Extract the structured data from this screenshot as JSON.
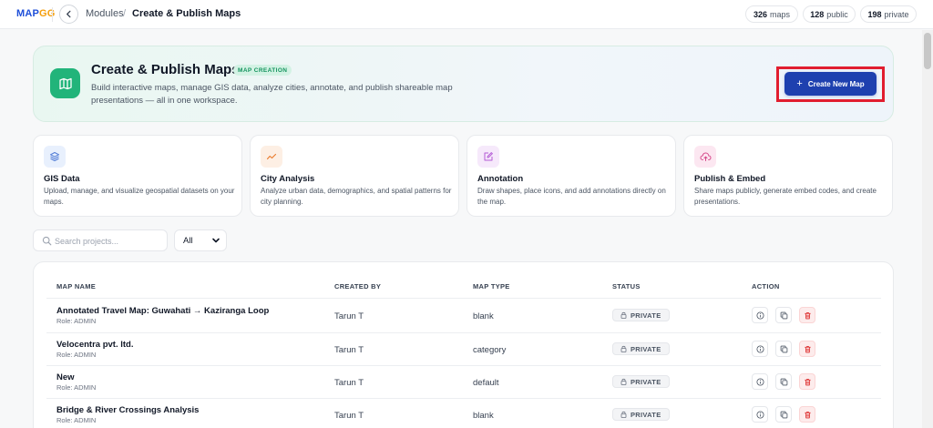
{
  "header": {
    "logo_prefix": "MAP",
    "logo_accent": "GG",
    "breadcrumb": {
      "parent": "Modules",
      "separator": "/",
      "current": "Create & Publish Maps"
    },
    "stats": [
      {
        "value": "326",
        "label": "maps"
      },
      {
        "value": "128",
        "label": "public"
      },
      {
        "value": "198",
        "label": "private"
      }
    ]
  },
  "hero": {
    "icon": "map-icon",
    "title": "Create & Publish Maps",
    "badge": "MAP CREATION",
    "description": "Build interactive maps, manage GIS data, analyze cities, annotate, and publish shareable map presentations — all in one workspace.",
    "cta_label": "Create New Map"
  },
  "features": [
    {
      "icon": "layers-icon",
      "title": "GIS Data",
      "desc": "Upload, manage, and visualize geospatial datasets on your maps.",
      "color": "#4f7bd6",
      "bg": "#e8f0fd"
    },
    {
      "icon": "trend-line-icon",
      "title": "City Analysis",
      "desc": "Analyze urban data, demographics, and spatial patterns for city planning.",
      "color": "#ea7a2a",
      "bg": "#fdefe4"
    },
    {
      "icon": "edit-square-icon",
      "title": "Annotation",
      "desc": "Draw shapes, place icons, and add annotations directly on the map.",
      "color": "#b45bd6",
      "bg": "#f6e9fb"
    },
    {
      "icon": "cloud-upload-icon",
      "title": "Publish & Embed",
      "desc": "Share maps publicly, generate embed codes, and create presentations.",
      "color": "#d64b8c",
      "bg": "#fce7f1"
    }
  ],
  "search": {
    "placeholder": "Search projects..."
  },
  "filter": {
    "selected": "All"
  },
  "table": {
    "columns": [
      "MAP NAME",
      "CREATED BY",
      "MAP TYPE",
      "STATUS",
      "ACTION"
    ],
    "rows": [
      {
        "name": "Annotated Travel Map: Guwahati → Kaziranga Loop",
        "role": "Role: ADMIN",
        "created_by": "Tarun T",
        "type": "blank",
        "status": "PRIVATE"
      },
      {
        "name": "Velocentra pvt. ltd.",
        "role": "Role: ADMIN",
        "created_by": "Tarun T",
        "type": "category",
        "status": "PRIVATE"
      },
      {
        "name": "New",
        "role": "Role: ADMIN",
        "created_by": "Tarun T",
        "type": "default",
        "status": "PRIVATE"
      },
      {
        "name": "Bridge & River Crossings Analysis",
        "role": "Role: ADMIN",
        "created_by": "Tarun T",
        "type": "blank",
        "status": "PRIVATE"
      }
    ]
  },
  "colors": {
    "accent": "#1e40af",
    "brand_green": "#21b47a",
    "danger": "#dc2626",
    "highlight_outline": "#e11d2f"
  }
}
